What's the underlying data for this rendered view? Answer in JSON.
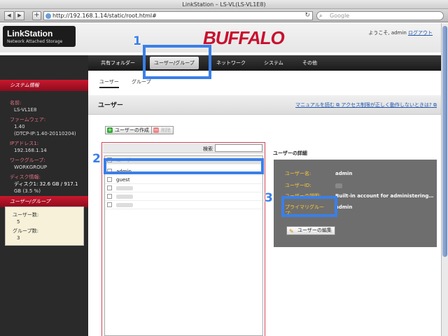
{
  "browser": {
    "window_title": "LinkStation – LS-VL(LS-VL1E8)",
    "back_icon": "back-arrow-icon",
    "forward_icon": "forward-arrow-icon",
    "add_icon": "plus-icon",
    "url": "http://192.168.1.14/static/root.html#",
    "reload_icon": "reload-icon",
    "search_placeholder": "Google"
  },
  "header": {
    "logo_title": "LinkStation",
    "logo_subtitle": "Network Attached Storage",
    "brand": "BUFFALO",
    "welcome": "ようこそ, admin",
    "logout": "ログアウト"
  },
  "menu": {
    "items": [
      "共有フォルダー",
      "ユーザー/グループ",
      "ネットワーク",
      "システム",
      "その他"
    ],
    "active_index": 1
  },
  "sidebar": {
    "system_info_title": "システム情報",
    "name_label": "名前:",
    "name_value": "LS-VL1E8",
    "firmware_label": "ファームウェア:",
    "firmware_value1": "1.40",
    "firmware_value2": "(DTCP-IP:1.40-20110204)",
    "ip_label": "IPアドレス1:",
    "ip_value": "192.168.1.14",
    "workgroup_label": "ワークグループ:",
    "workgroup_value": "WORKGROUP",
    "disk_label": "ディスク情報:",
    "disk_value1": "ディスク1: 32.6 GB / 917.1",
    "disk_value2": "GB (3.5 %)",
    "usergroup_title": "ユーザー/グループ",
    "user_count_label": "ユーザー数:",
    "user_count": "5",
    "group_count_label": "グループ数:",
    "group_count": "3"
  },
  "subtabs": [
    "ユーザー",
    "グループ"
  ],
  "section": {
    "title": "ユーザー",
    "help_link": "マニュアルを読む",
    "access_link": "アクセス制限が正しく動作しないときは?"
  },
  "actions": {
    "create_user": "ユーザーの作成",
    "delete": "削除"
  },
  "list": {
    "search_label": "検索",
    "column_header": "ユーザー",
    "users": [
      "admin",
      "guest"
    ]
  },
  "details": {
    "title": "ユーザーの詳細",
    "username_label": "ユーザー名:",
    "username_value": "admin",
    "userid_label": "ユーザーID:",
    "description_label": "ユーザーの説明:",
    "description_value": "Built-in account for administering…",
    "primary_group_label": "プライマリグループ:",
    "primary_group_value": "admin",
    "edit_button": "ユーザーの編集"
  },
  "annotations": [
    "1",
    "2",
    "3"
  ],
  "colors": {
    "brand_red": "#c8102e",
    "highlight_blue": "#3a7fe8",
    "detail_label_yellow": "#ffcc33"
  }
}
